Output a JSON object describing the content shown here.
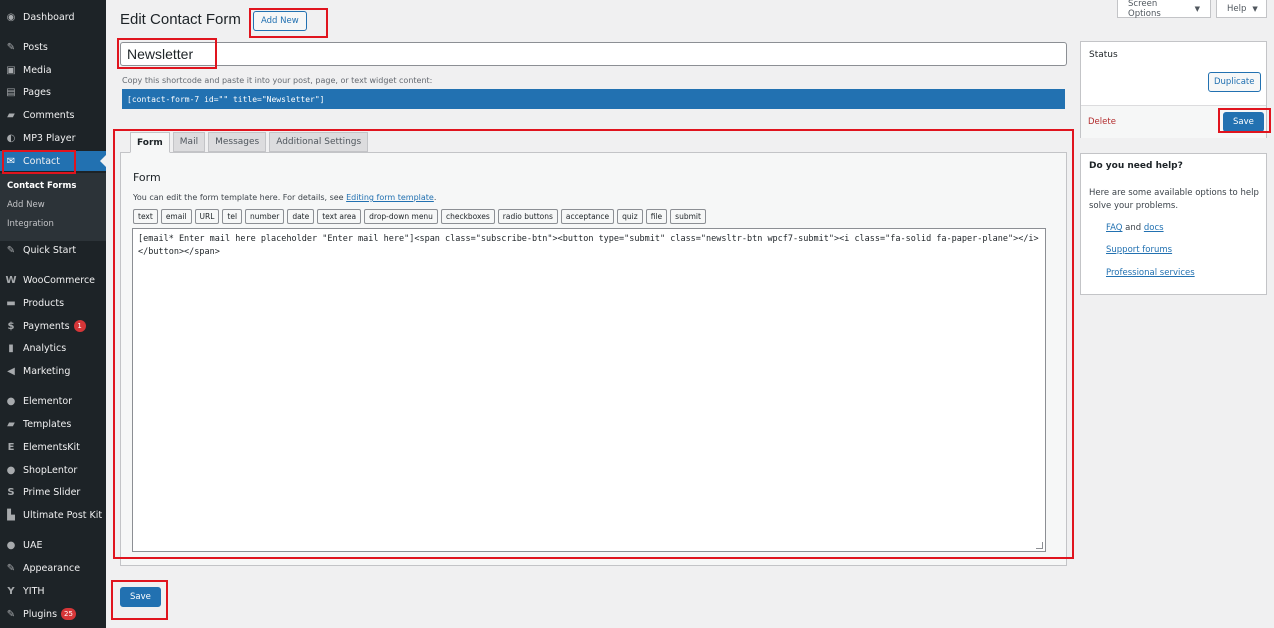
{
  "sidebar": {
    "items": [
      {
        "label": "Dashboard",
        "icon": "dashboard-icon",
        "glyph": "◉"
      },
      {
        "label": "Posts",
        "icon": "pin-icon",
        "glyph": "✎"
      },
      {
        "label": "Media",
        "icon": "media-icon",
        "glyph": "▣"
      },
      {
        "label": "Pages",
        "icon": "pages-icon",
        "glyph": "▤"
      },
      {
        "label": "Comments",
        "icon": "comments-icon",
        "glyph": "▰"
      },
      {
        "label": "MP3 Player",
        "icon": "audio-icon",
        "glyph": "◐"
      },
      {
        "label": "Contact",
        "icon": "mail-icon",
        "glyph": "✉"
      },
      {
        "label": "Quick Start",
        "icon": "quick-start-icon",
        "glyph": "✎"
      },
      {
        "label": "WooCommerce",
        "icon": "woocommerce-icon",
        "glyph": "W"
      },
      {
        "label": "Products",
        "icon": "products-icon",
        "glyph": "▬"
      },
      {
        "label": "Payments",
        "icon": "payments-icon",
        "glyph": "$",
        "badge": "1"
      },
      {
        "label": "Analytics",
        "icon": "analytics-icon",
        "glyph": "▮"
      },
      {
        "label": "Marketing",
        "icon": "megaphone-icon",
        "glyph": "◀"
      },
      {
        "label": "Elementor",
        "icon": "elementor-icon",
        "glyph": "●"
      },
      {
        "label": "Templates",
        "icon": "templates-icon",
        "glyph": "▰"
      },
      {
        "label": "ElementsKit",
        "icon": "elementskit-icon",
        "glyph": "E"
      },
      {
        "label": "ShopLentor",
        "icon": "shoplentor-icon",
        "glyph": "●"
      },
      {
        "label": "Prime Slider",
        "icon": "prime-slider-icon",
        "glyph": "S"
      },
      {
        "label": "Ultimate Post Kit",
        "icon": "post-kit-icon",
        "glyph": "▙"
      },
      {
        "label": "UAE",
        "icon": "uae-icon",
        "glyph": "●"
      },
      {
        "label": "Appearance",
        "icon": "appearance-icon",
        "glyph": "✎"
      },
      {
        "label": "YITH",
        "icon": "yith-icon",
        "glyph": "Y"
      },
      {
        "label": "Plugins",
        "icon": "plugins-icon",
        "glyph": "✎",
        "badge": "25"
      }
    ],
    "submenu": [
      "Contact Forms",
      "Add New",
      "Integration"
    ]
  },
  "top": {
    "screen_options": "Screen Options",
    "help": "Help"
  },
  "header": {
    "title": "Edit Contact Form",
    "add_new": "Add New"
  },
  "form_title": "Newsletter",
  "shortcode": {
    "label": "Copy this shortcode and paste it into your post, page, or text widget content:",
    "code": "[contact-form-7 id=\"\" title=\"Newsletter\"]"
  },
  "tabs": [
    "Form",
    "Mail",
    "Messages",
    "Additional Settings"
  ],
  "panel": {
    "heading": "Form",
    "desc_prefix": "You can edit the form template here. For details, see ",
    "desc_link": "Editing form template",
    "desc_suffix": ".",
    "tag_buttons": [
      "text",
      "email",
      "URL",
      "tel",
      "number",
      "date",
      "text area",
      "drop-down menu",
      "checkboxes",
      "radio buttons",
      "acceptance",
      "quiz",
      "file",
      "submit"
    ],
    "template": "[email* Enter mail here placeholder \"Enter mail here\"]<span class=\"subscribe-btn\"><button type=\"submit\" class=\"newsltr-btn wpcf7-submit\"><i class=\"fa-solid fa-paper-plane\"></i></button></span>"
  },
  "status": {
    "heading": "Status",
    "duplicate": "Duplicate",
    "delete": "Delete",
    "save": "Save"
  },
  "help": {
    "heading": "Do you need help?",
    "text": "Here are some available options to help solve your problems.",
    "faq": "FAQ",
    "and": "and",
    "docs": "docs",
    "support": "Support forums",
    "professional": "Professional services"
  },
  "save_bottom": "Save"
}
